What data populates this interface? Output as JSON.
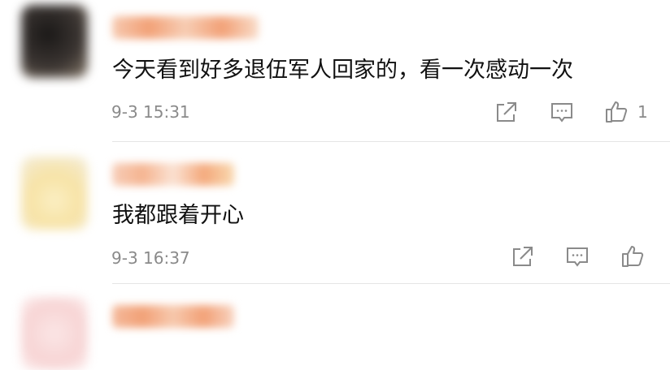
{
  "comments": [
    {
      "text": "今天看到好多退伍军人回家的，看一次感动一次",
      "time": "9-3 15:31",
      "likes": "1",
      "avatar_color": "#2e2a28",
      "name_color": "#f2a177"
    },
    {
      "text": "我都跟着开心",
      "time": "9-3 16:37",
      "likes": "",
      "avatar_color": "#f5e6b8",
      "name_color": "#f5b490"
    },
    {
      "avatar_color": "#f9dede",
      "name_color": "#f2a177"
    }
  ],
  "icons": {
    "share": "share-icon",
    "reply": "comment-icon",
    "like": "thumbs-up-icon"
  },
  "colors": {
    "text": "#111111",
    "meta": "#8a8a8a",
    "divider": "#e5e5e5"
  }
}
